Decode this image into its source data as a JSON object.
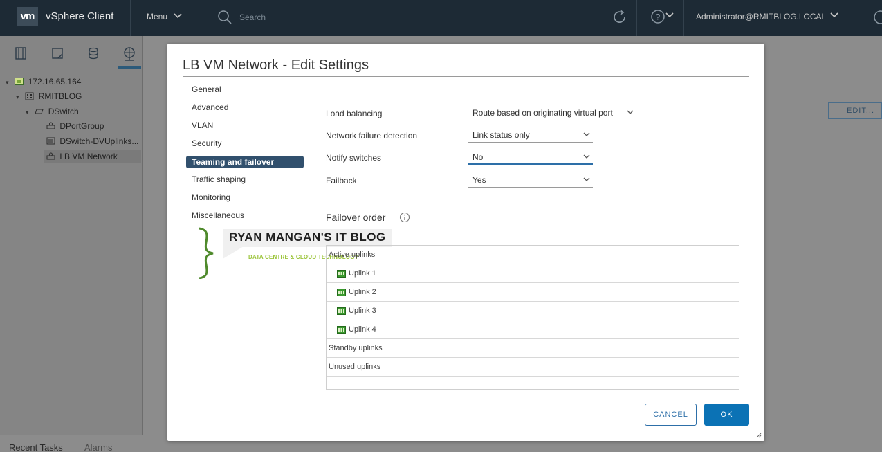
{
  "header": {
    "logo_text": "vm",
    "app_title": "vSphere Client",
    "menu_label": "Menu",
    "search_placeholder": "Search",
    "user": "Administrator@RMITBLOG.LOCAL"
  },
  "navigator": {
    "tabs": [
      "hosts-and-clusters",
      "vms-and-templates",
      "storage",
      "networking"
    ],
    "active_tab": "networking",
    "tree": [
      {
        "label": "172.16.65.164",
        "icon": "datacenter-icon",
        "level": 0,
        "expanded": true
      },
      {
        "label": "RMITBLOG",
        "icon": "datacenter-building-icon",
        "level": 1,
        "expanded": true
      },
      {
        "label": "DSwitch",
        "icon": "distributed-switch-icon",
        "level": 2,
        "expanded": true
      },
      {
        "label": "DPortGroup",
        "icon": "portgroup-icon",
        "level": 3
      },
      {
        "label": "DSwitch-DVUplinks...",
        "icon": "uplink-portgroup-icon",
        "level": 3
      },
      {
        "label": "LB VM Network",
        "icon": "portgroup-icon",
        "level": 3,
        "selected": true
      }
    ]
  },
  "background": {
    "edit_button": "EDIT..."
  },
  "bottom": {
    "tabs": [
      "Recent Tasks",
      "Alarms"
    ]
  },
  "modal": {
    "title": "LB VM Network - Edit Settings",
    "nav": [
      "General",
      "Advanced",
      "VLAN",
      "Security",
      "Teaming and failover",
      "Traffic shaping",
      "Monitoring",
      "Miscellaneous"
    ],
    "active_nav": "Teaming and failover",
    "fields": [
      {
        "label": "Load balancing",
        "value": "Route based on originating virtual port"
      },
      {
        "label": "Network failure detection",
        "value": "Link status only"
      },
      {
        "label": "Notify switches",
        "value": "No"
      },
      {
        "label": "Failback",
        "value": "Yes"
      }
    ],
    "failover_title": "Failover order",
    "failover_rows": [
      {
        "label": "Active uplinks",
        "type": "group"
      },
      {
        "label": "Uplink 1",
        "type": "uplink"
      },
      {
        "label": "Uplink 2",
        "type": "uplink"
      },
      {
        "label": "Uplink 3",
        "type": "uplink"
      },
      {
        "label": "Uplink 4",
        "type": "uplink"
      },
      {
        "label": "Standby uplinks",
        "type": "group"
      },
      {
        "label": "Unused uplinks",
        "type": "group"
      }
    ],
    "watermark": {
      "brace": "}",
      "main": "RYAN MANGAN'S IT BLOG",
      "sub": "DATA CENTRE & CLOUD TECHNOLOGY"
    },
    "cancel_label": "CANCEL",
    "ok_label": "OK"
  },
  "colors": {
    "header_bg": "#1d2a35",
    "active_nav_bg": "#31506d",
    "primary_button": "#0b72b5",
    "focus_underline": "#2d6fa8",
    "nic_green": "#3a9a2e",
    "watermark_green": "#9bc43a"
  }
}
